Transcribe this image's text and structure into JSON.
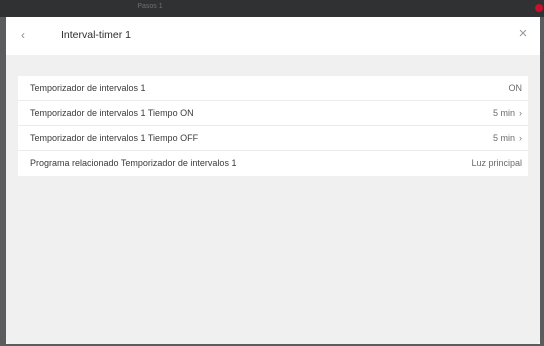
{
  "background_window": {
    "title": "Pasos 1"
  },
  "dialog": {
    "title": "Interval-timer 1",
    "back_icon": "chevron-left-icon",
    "close_icon": "close-icon"
  },
  "settings": [
    {
      "label": "Temporizador de intervalos 1",
      "value": "ON",
      "chevron": ""
    },
    {
      "label": "Temporizador de intervalos 1 Tiempo ON",
      "value": "5 min",
      "chevron": "›"
    },
    {
      "label": "Temporizador de intervalos 1 Tiempo OFF",
      "value": "5 min",
      "chevron": "›"
    },
    {
      "label": "Programa relacionado Temporizador de intervalos 1",
      "value": "Luz principal",
      "chevron": ""
    }
  ],
  "colors": {
    "panel_background": "#f0f0f0",
    "row_background": "#ffffff",
    "frame_dark": "#2f3133",
    "badge_red": "#c8102e"
  }
}
